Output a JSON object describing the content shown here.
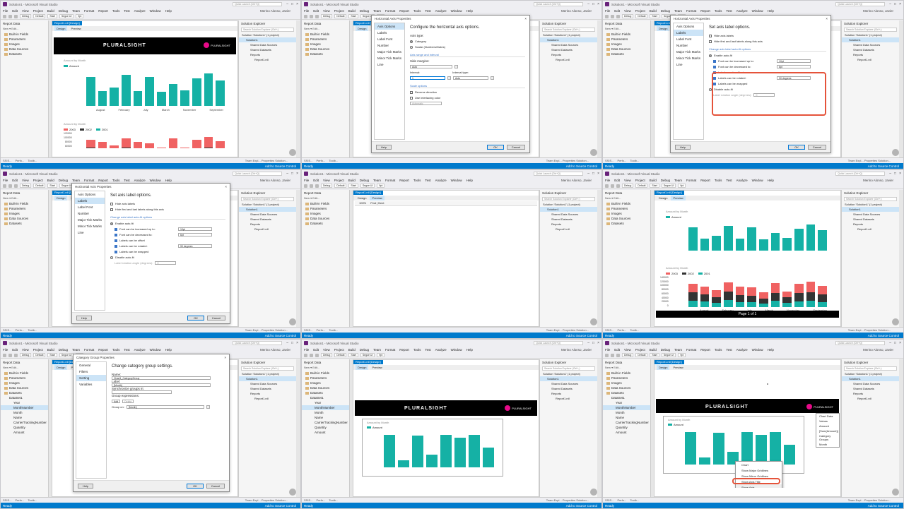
{
  "vs": {
    "title": "Solution1 - Microsoft Visual Studio",
    "quick_launch": "Quick Launch (Ctrl+Q)",
    "menu": [
      "File",
      "Edit",
      "View",
      "Project",
      "Build",
      "Debug",
      "Team",
      "Format",
      "Report",
      "Tools",
      "Test",
      "Analyze",
      "Window",
      "Help"
    ],
    "user": "Merino Alonso, Javier",
    "config": "Debug",
    "platform": "Default",
    "start": "Start",
    "font": "Segoe UI",
    "font_size": "9pt",
    "status": "Ready",
    "source_control": "Add to Source Control",
    "doc_tab": "Report1.rdl [Design]",
    "design": "Design",
    "preview": "Preview",
    "report_data": "Report Data",
    "new_edit": "New ▾  Edit...",
    "tree": [
      "Built-in Fields",
      "Parameters",
      "Images",
      "Data Sources",
      "Datasets"
    ],
    "dataset_name": "DataSet1",
    "fields": [
      "Year",
      "MonthNumber",
      "Month",
      "Name",
      "CarrierTrackingNumber",
      "Quantity",
      "Amount"
    ],
    "solution_explorer": "Solution Explorer",
    "se_search": "Search Solution Explorer (Ctrl+;)",
    "se_items": [
      "Solution 'Solution1' (1 project)",
      "Solution1",
      "Shared Data Sources",
      "Shared Datasets",
      "Reports",
      "Report1.rdl"
    ],
    "bottom_tabs_left": [
      "SSIS...",
      "Perfo...",
      "Toolb..."
    ],
    "bottom_tabs_right": "Team Expl...  Properties  Solution...",
    "row_groups": "Row Groups",
    "column_groups": "Column Groups",
    "zoom": "100%",
    "find": "Find | Next",
    "page": "Page 1 of 1"
  },
  "report": {
    "banner": "PLURALSIGHT",
    "logo_text": "PLURALSIGHT",
    "chart1_title": "Amount by Month",
    "legend1": "Amount",
    "chart2_title": "Amount by Month",
    "legend2": [
      "2003",
      "2002",
      "2001"
    ]
  },
  "chart_data": [
    {
      "type": "bar",
      "title": "Amount by Month",
      "series": [
        {
          "name": "Amount",
          "values": [
            58,
            30,
            36,
            62,
            30,
            57,
            28,
            44,
            31,
            55,
            64,
            50
          ]
        }
      ],
      "categories": [
        "August",
        "February",
        "July",
        "March",
        "November",
        "September"
      ],
      "colors": [
        "#15b1a5"
      ]
    },
    {
      "type": "bar",
      "title": "Amount by Month",
      "yticks": [
        "140000",
        "120000",
        "100000",
        "80000",
        "60000",
        "40000",
        "20000",
        "0"
      ],
      "categories": [
        "August",
        "February",
        "July",
        "March",
        "November",
        "September"
      ],
      "series": [
        {
          "name": "2003",
          "values": [
            30,
            28,
            26,
            34,
            30,
            28,
            22,
            36,
            20,
            33,
            38,
            32
          ]
        },
        {
          "name": "2002",
          "values": [
            30,
            25,
            20,
            30,
            25,
            24,
            18,
            28,
            20,
            28,
            30,
            26
          ]
        },
        {
          "name": "2001",
          "values": [
            22,
            20,
            15,
            24,
            18,
            17,
            13,
            22,
            14,
            21,
            23,
            18
          ]
        }
      ],
      "colors": [
        "#f06262",
        "#333333",
        "#15b1a5"
      ]
    }
  ],
  "axis_dialog": {
    "title": "Horizontal Axis Properties",
    "nav": [
      "Axis Options",
      "Labels",
      "Label Font",
      "Number",
      "Major Tick Marks",
      "Minor Tick Marks",
      "Line"
    ],
    "heading": "Configure the horizontal axis options.",
    "axis_type": "Axis type:",
    "category": "Category",
    "scalar": "Scalar (Numbers/Dates)",
    "range": "Axis range and interval",
    "side_margins": "Side margins:",
    "auto": "Auto",
    "interval": "Interval:",
    "interval_val": "1",
    "interval_type": "Interval type:",
    "scale_options": "Scale options",
    "reverse": "Reverse direction",
    "interlacing": "Use interlacing color",
    "automatic": "Automatic",
    "help": "Help",
    "ok": "OK",
    "cancel": "Cancel"
  },
  "labels_dialog": {
    "heading": "Set axis label options.",
    "hide_labels": "Hide axis labels",
    "hide_first_last": "Hide first and last labels along this axis",
    "autofit_section": "Change axis label auto-fit options",
    "enable_autofit": "Enable auto-fit",
    "font_increase": "Font can be increased up to:",
    "font_increase_val": "10pt",
    "font_decrease": "Font can be decreased to:",
    "font_decrease_val": "6pt",
    "offset": "Labels can be offset",
    "rotated": "Labels can be rotated:",
    "rotated_val": "90 degrees",
    "wrapped": "Labels can be wrapped",
    "disable_autofit": "Disable auto-fit",
    "rotation_angle": "Label rotation angle (degrees):",
    "rotation_val": "0"
  },
  "group_dialog": {
    "title": "Category Group Properties",
    "nav": [
      "General",
      "Filters",
      "Sorting",
      "Variables"
    ],
    "heading": "Change category group settings.",
    "name_label": "Name:",
    "name_val": "Chart1_CategoryGroup",
    "label_label": "Label:",
    "label_val": "[Month]",
    "sync": "Synchronize groups in:",
    "group_expr": "Group expressions:",
    "add": "Add",
    "delete": "Delete",
    "group_on": "Group on:",
    "group_on_val": "[Month]"
  },
  "ctx_menu": {
    "items": [
      "Chart",
      "Show Major Gridlines",
      "Show Minor Gridlines",
      "Show Axis Title",
      "Show Axis",
      "Horizontal Axis Properties..."
    ]
  },
  "chart_data_panel": {
    "title": "Chart Data",
    "values": "Values",
    "amount": "Amount",
    "sum": "[Sum(Amount)]",
    "cat_groups": "Category Groups",
    "month": "Month"
  },
  "preview_bottom": {
    "chart1": [
      58,
      30,
      36,
      62,
      30,
      57,
      28,
      44,
      31,
      55,
      64,
      50
    ],
    "chart2_title": "Amount by Month"
  },
  "design_chart": {
    "title": "Amount by Month",
    "values": [
      80,
      18,
      78,
      32,
      80,
      72,
      80,
      48
    ]
  }
}
